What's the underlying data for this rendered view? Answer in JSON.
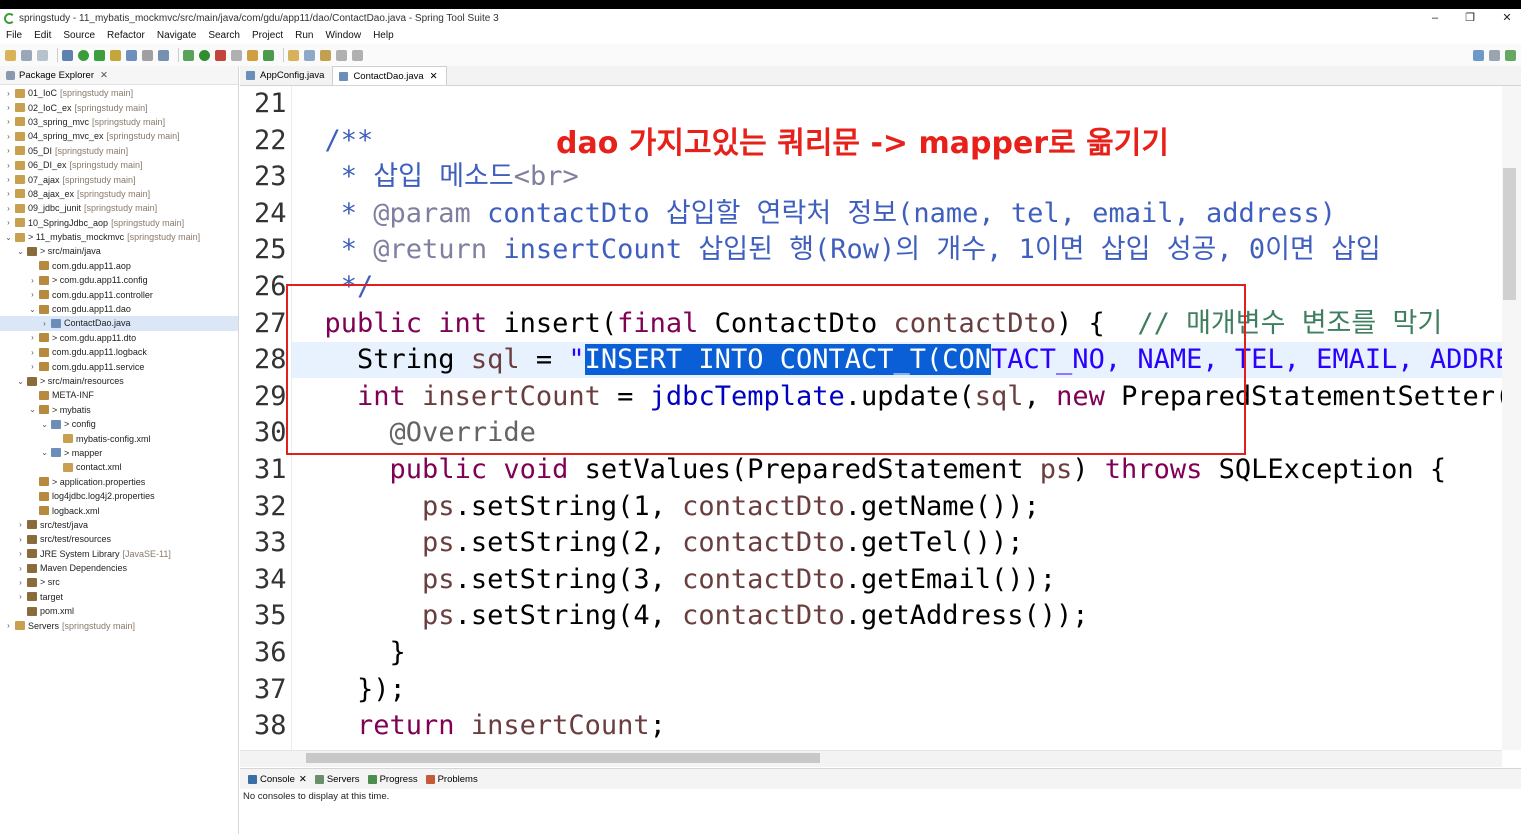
{
  "window": {
    "title": "springstudy - 11_mybatis_mockmvc/src/main/java/com/gdu/app11/dao/ContactDao.java - Spring Tool Suite 3",
    "minimize": "–",
    "maximize": "❐",
    "close": "✕"
  },
  "menu": [
    "File",
    "Edit",
    "Source",
    "Refactor",
    "Navigate",
    "Search",
    "Project",
    "Run",
    "Window",
    "Help"
  ],
  "package_explorer": {
    "tab_label": "Package Explorer",
    "items": [
      {
        "indent": 0,
        "arrow": "›",
        "label": "01_IoC",
        "tag": "[springstudy main]"
      },
      {
        "indent": 0,
        "arrow": "›",
        "label": "02_IoC_ex",
        "tag": "[springstudy main]"
      },
      {
        "indent": 0,
        "arrow": "›",
        "label": "03_spring_mvc",
        "tag": "[springstudy main]"
      },
      {
        "indent": 0,
        "arrow": "›",
        "label": "04_spring_mvc_ex",
        "tag": "[springstudy main]"
      },
      {
        "indent": 0,
        "arrow": "›",
        "label": "05_DI",
        "tag": "[springstudy main]"
      },
      {
        "indent": 0,
        "arrow": "›",
        "label": "06_DI_ex",
        "tag": "[springstudy main]"
      },
      {
        "indent": 0,
        "arrow": "›",
        "label": "07_ajax",
        "tag": "[springstudy main]"
      },
      {
        "indent": 0,
        "arrow": "›",
        "label": "08_ajax_ex",
        "tag": "[springstudy main]"
      },
      {
        "indent": 0,
        "arrow": "›",
        "label": "09_jdbc_junit",
        "tag": "[springstudy main]"
      },
      {
        "indent": 0,
        "arrow": "›",
        "label": "10_SpringJdbc_aop",
        "tag": "[springstudy main]"
      },
      {
        "indent": 0,
        "arrow": "⌄",
        "label": "> 11_mybatis_mockmvc",
        "tag": "[springstudy main]"
      },
      {
        "indent": 1,
        "arrow": "⌄",
        "label": "> src/main/java",
        "tag": ""
      },
      {
        "indent": 2,
        "arrow": "",
        "label": "com.gdu.app11.aop",
        "tag": ""
      },
      {
        "indent": 2,
        "arrow": "›",
        "label": "> com.gdu.app11.config",
        "tag": ""
      },
      {
        "indent": 2,
        "arrow": "›",
        "label": "com.gdu.app11.controller",
        "tag": ""
      },
      {
        "indent": 2,
        "arrow": "⌄",
        "label": "com.gdu.app11.dao",
        "tag": ""
      },
      {
        "indent": 3,
        "arrow": "›",
        "label": "ContactDao.java",
        "tag": ""
      },
      {
        "indent": 2,
        "arrow": "›",
        "label": "> com.gdu.app11.dto",
        "tag": ""
      },
      {
        "indent": 2,
        "arrow": "›",
        "label": "com.gdu.app11.logback",
        "tag": ""
      },
      {
        "indent": 2,
        "arrow": "›",
        "label": "com.gdu.app11.service",
        "tag": ""
      },
      {
        "indent": 1,
        "arrow": "⌄",
        "label": "> src/main/resources",
        "tag": ""
      },
      {
        "indent": 2,
        "arrow": "",
        "label": "META-INF",
        "tag": ""
      },
      {
        "indent": 2,
        "arrow": "⌄",
        "label": "> mybatis",
        "tag": ""
      },
      {
        "indent": 3,
        "arrow": "⌄",
        "label": "> config",
        "tag": ""
      },
      {
        "indent": 4,
        "arrow": "",
        "label": "mybatis-config.xml",
        "tag": ""
      },
      {
        "indent": 3,
        "arrow": "⌄",
        "label": "> mapper",
        "tag": ""
      },
      {
        "indent": 4,
        "arrow": "",
        "label": "contact.xml",
        "tag": ""
      },
      {
        "indent": 2,
        "arrow": "",
        "label": "> application.properties",
        "tag": ""
      },
      {
        "indent": 2,
        "arrow": "",
        "label": "log4jdbc.log4j2.properties",
        "tag": ""
      },
      {
        "indent": 2,
        "arrow": "",
        "label": "logback.xml",
        "tag": ""
      },
      {
        "indent": 1,
        "arrow": "›",
        "label": "src/test/java",
        "tag": ""
      },
      {
        "indent": 1,
        "arrow": "›",
        "label": "src/test/resources",
        "tag": ""
      },
      {
        "indent": 1,
        "arrow": "›",
        "label": "JRE System Library",
        "tag": "[JavaSE-11]"
      },
      {
        "indent": 1,
        "arrow": "›",
        "label": "Maven Dependencies",
        "tag": ""
      },
      {
        "indent": 1,
        "arrow": "›",
        "label": "> src",
        "tag": ""
      },
      {
        "indent": 1,
        "arrow": "›",
        "label": "target",
        "tag": ""
      },
      {
        "indent": 1,
        "arrow": "",
        "label": "pom.xml",
        "tag": ""
      },
      {
        "indent": 0,
        "arrow": "›",
        "label": "Servers",
        "tag": "[springstudy main]"
      }
    ],
    "selected_index": 16
  },
  "editor": {
    "tabs": [
      {
        "label": "AppConfig.java",
        "active": false
      },
      {
        "label": "ContactDao.java",
        "active": true
      }
    ],
    "annotation": "dao 가지고있는 쿼리문 -> mapper로 옮기기",
    "line_numbers": [
      "21",
      "22",
      "23",
      "24",
      "25",
      "26",
      "27",
      "28",
      "29",
      "30",
      "31",
      "32",
      "33",
      "34",
      "35",
      "36",
      "37",
      "38"
    ],
    "code_lines": [
      [
        {
          "t": "",
          "c": "plain"
        }
      ],
      [
        {
          "t": "  /**",
          "c": "com"
        }
      ],
      [
        {
          "t": "   * 삽입 메소드",
          "c": "com"
        },
        {
          "t": "<br>",
          "c": "tag"
        }
      ],
      [
        {
          "t": "   * ",
          "c": "com"
        },
        {
          "t": "@param",
          "c": "tag"
        },
        {
          "t": " contactDto 삽입할 연락처 정보(name, tel, email, address)",
          "c": "com"
        }
      ],
      [
        {
          "t": "   * ",
          "c": "com"
        },
        {
          "t": "@return",
          "c": "tag"
        },
        {
          "t": " insertCount 삽입된 행(Row)의 개수, 1이면 삽입 성공, 0이면 삽입",
          "c": "com"
        }
      ],
      [
        {
          "t": "   */",
          "c": "com"
        }
      ],
      [
        {
          "t": "  ",
          "c": "plain"
        },
        {
          "t": "public int",
          "c": "kw"
        },
        {
          "t": " insert(",
          "c": "plain"
        },
        {
          "t": "final",
          "c": "kw"
        },
        {
          "t": " ContactDto ",
          "c": "plain"
        },
        {
          "t": "contactDto",
          "c": "var"
        },
        {
          "t": ") {  ",
          "c": "plain"
        },
        {
          "t": "// 매개변수 변조를 막기",
          "c": "lcom"
        }
      ],
      [
        {
          "t": "    String ",
          "c": "plain"
        },
        {
          "t": "sql",
          "c": "var"
        },
        {
          "t": " = ",
          "c": "plain"
        },
        {
          "t": "\"",
          "c": "str"
        },
        {
          "t": "INSERT INTO CONTACT_T(CON",
          "c": "sel"
        },
        {
          "t": "TACT_NO, NAME, TEL, EMAIL, ADDRES",
          "c": "str"
        }
      ],
      [
        {
          "t": "    ",
          "c": "plain"
        },
        {
          "t": "int",
          "c": "kw"
        },
        {
          "t": " ",
          "c": "plain"
        },
        {
          "t": "insertCount",
          "c": "var"
        },
        {
          "t": " = ",
          "c": "plain"
        },
        {
          "t": "jdbcTemplate",
          "c": "fld"
        },
        {
          "t": ".update(",
          "c": "plain"
        },
        {
          "t": "sql",
          "c": "var"
        },
        {
          "t": ", ",
          "c": "plain"
        },
        {
          "t": "new",
          "c": "kw"
        },
        {
          "t": " PreparedStatementSetter()",
          "c": "plain"
        }
      ],
      [
        {
          "t": "      ",
          "c": "plain"
        },
        {
          "t": "@Override",
          "c": "ann"
        }
      ],
      [
        {
          "t": "      ",
          "c": "plain"
        },
        {
          "t": "public void",
          "c": "kw"
        },
        {
          "t": " setValues(PreparedStatement ",
          "c": "plain"
        },
        {
          "t": "ps",
          "c": "var"
        },
        {
          "t": ") ",
          "c": "plain"
        },
        {
          "t": "throws",
          "c": "kw"
        },
        {
          "t": " SQLException {",
          "c": "plain"
        }
      ],
      [
        {
          "t": "        ",
          "c": "plain"
        },
        {
          "t": "ps",
          "c": "var"
        },
        {
          "t": ".setString(1, ",
          "c": "plain"
        },
        {
          "t": "contactDto",
          "c": "var"
        },
        {
          "t": ".getName());",
          "c": "plain"
        }
      ],
      [
        {
          "t": "        ",
          "c": "plain"
        },
        {
          "t": "ps",
          "c": "var"
        },
        {
          "t": ".setString(2, ",
          "c": "plain"
        },
        {
          "t": "contactDto",
          "c": "var"
        },
        {
          "t": ".getTel());",
          "c": "plain"
        }
      ],
      [
        {
          "t": "        ",
          "c": "plain"
        },
        {
          "t": "ps",
          "c": "var"
        },
        {
          "t": ".setString(3, ",
          "c": "plain"
        },
        {
          "t": "contactDto",
          "c": "var"
        },
        {
          "t": ".getEmail());",
          "c": "plain"
        }
      ],
      [
        {
          "t": "        ",
          "c": "plain"
        },
        {
          "t": "ps",
          "c": "var"
        },
        {
          "t": ".setString(4, ",
          "c": "plain"
        },
        {
          "t": "contactDto",
          "c": "var"
        },
        {
          "t": ".getAddress());",
          "c": "plain"
        }
      ],
      [
        {
          "t": "      }",
          "c": "plain"
        }
      ],
      [
        {
          "t": "    });",
          "c": "plain"
        }
      ],
      [
        {
          "t": "    ",
          "c": "plain"
        },
        {
          "t": "return",
          "c": "kw"
        },
        {
          "t": " ",
          "c": "plain"
        },
        {
          "t": "insertCount",
          "c": "var"
        },
        {
          "t": ";",
          "c": "plain"
        }
      ]
    ]
  },
  "console": {
    "tabs": [
      "Console",
      "Servers",
      "Progress",
      "Problems"
    ],
    "message": "No consoles to display at this time."
  },
  "colors": {
    "selection": "#0a5fd6",
    "annotation_red": "#e8201a",
    "keyword": "#7f0055",
    "comment": "#3f5fbf"
  }
}
